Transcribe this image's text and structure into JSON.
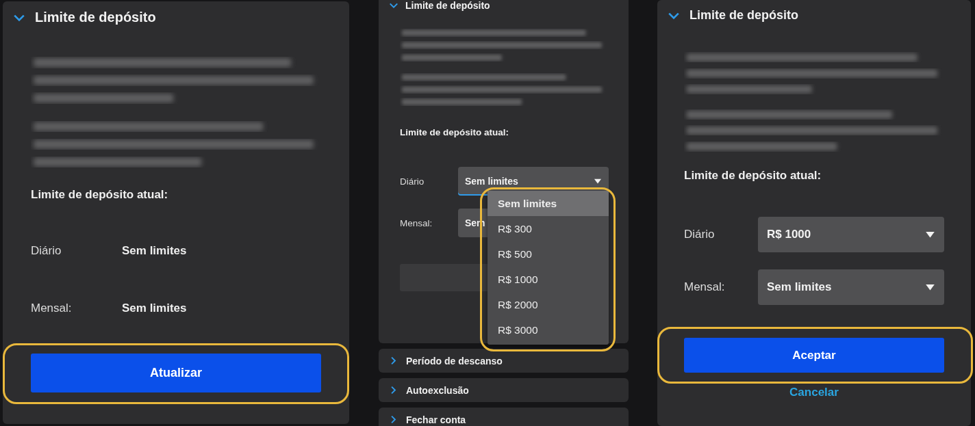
{
  "panels": [
    {
      "kind": "summary",
      "title": "Limite de depósito",
      "expanded": true,
      "current_label": "Limite de depósito atual:",
      "limits": [
        {
          "label": "Diário",
          "value": "Sem limites"
        },
        {
          "label": "Mensal:",
          "value": "Sem limites"
        }
      ],
      "primary_button": {
        "label": "Atualizar",
        "highlighted": true
      }
    },
    {
      "kind": "dropdown",
      "title": "Limite de depósito",
      "expanded": true,
      "current_label": "Limite de depósito atual:",
      "limits": [
        {
          "label": "Diário",
          "value": "Sem limites",
          "open": true
        },
        {
          "label": "Mensal:",
          "value": "Sem",
          "open": false
        }
      ],
      "options": [
        {
          "label": "Sem limites",
          "selected": true
        },
        {
          "label": "R$ 300",
          "selected": false
        },
        {
          "label": "R$ 500",
          "selected": false
        },
        {
          "label": "R$ 1000",
          "selected": false
        },
        {
          "label": "R$ 2000",
          "selected": false
        },
        {
          "label": "R$ 3000",
          "selected": false
        }
      ],
      "menu_highlighted": true,
      "sections": [
        {
          "title": "Período de descanso",
          "expanded": false
        },
        {
          "title": "Autoexclusão",
          "expanded": false
        },
        {
          "title": "Fechar conta",
          "expanded": false
        }
      ]
    },
    {
      "kind": "edit",
      "title": "Limite de depósito",
      "expanded": true,
      "current_label": "Limite de depósito atual:",
      "limits": [
        {
          "label": "Diário",
          "value": "R$ 1000",
          "open": false
        },
        {
          "label": "Mensal:",
          "value": "Sem limites",
          "open": false
        }
      ],
      "primary_button": {
        "label": "Aceptar",
        "highlighted": true
      },
      "secondary_link": "Cancelar"
    }
  ]
}
